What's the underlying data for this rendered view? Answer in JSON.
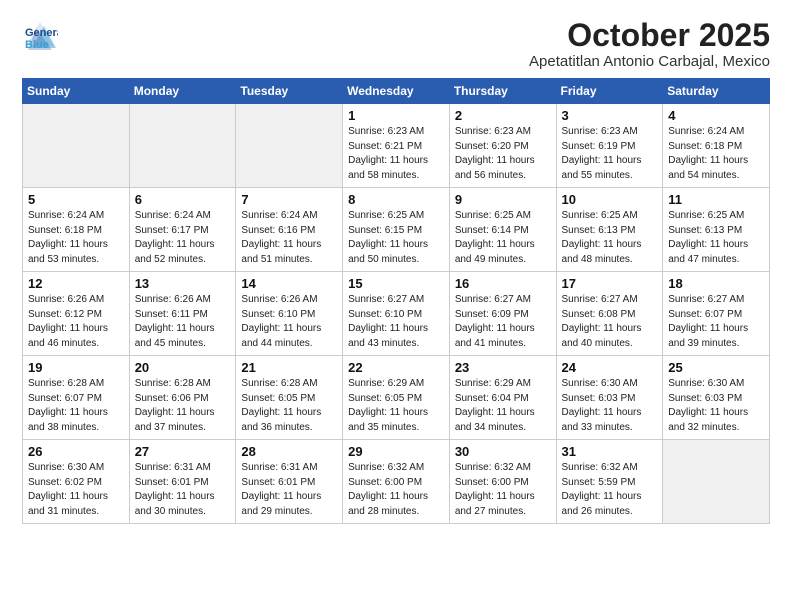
{
  "header": {
    "logo_general": "General",
    "logo_blue": "Blue",
    "month_title": "October 2025",
    "location": "Apetatitlan Antonio Carbajal, Mexico"
  },
  "weekdays": [
    "Sunday",
    "Monday",
    "Tuesday",
    "Wednesday",
    "Thursday",
    "Friday",
    "Saturday"
  ],
  "weeks": [
    [
      {
        "day": "",
        "info": ""
      },
      {
        "day": "",
        "info": ""
      },
      {
        "day": "",
        "info": ""
      },
      {
        "day": "1",
        "info": "Sunrise: 6:23 AM\nSunset: 6:21 PM\nDaylight: 11 hours\nand 58 minutes."
      },
      {
        "day": "2",
        "info": "Sunrise: 6:23 AM\nSunset: 6:20 PM\nDaylight: 11 hours\nand 56 minutes."
      },
      {
        "day": "3",
        "info": "Sunrise: 6:23 AM\nSunset: 6:19 PM\nDaylight: 11 hours\nand 55 minutes."
      },
      {
        "day": "4",
        "info": "Sunrise: 6:24 AM\nSunset: 6:18 PM\nDaylight: 11 hours\nand 54 minutes."
      }
    ],
    [
      {
        "day": "5",
        "info": "Sunrise: 6:24 AM\nSunset: 6:18 PM\nDaylight: 11 hours\nand 53 minutes."
      },
      {
        "day": "6",
        "info": "Sunrise: 6:24 AM\nSunset: 6:17 PM\nDaylight: 11 hours\nand 52 minutes."
      },
      {
        "day": "7",
        "info": "Sunrise: 6:24 AM\nSunset: 6:16 PM\nDaylight: 11 hours\nand 51 minutes."
      },
      {
        "day": "8",
        "info": "Sunrise: 6:25 AM\nSunset: 6:15 PM\nDaylight: 11 hours\nand 50 minutes."
      },
      {
        "day": "9",
        "info": "Sunrise: 6:25 AM\nSunset: 6:14 PM\nDaylight: 11 hours\nand 49 minutes."
      },
      {
        "day": "10",
        "info": "Sunrise: 6:25 AM\nSunset: 6:13 PM\nDaylight: 11 hours\nand 48 minutes."
      },
      {
        "day": "11",
        "info": "Sunrise: 6:25 AM\nSunset: 6:13 PM\nDaylight: 11 hours\nand 47 minutes."
      }
    ],
    [
      {
        "day": "12",
        "info": "Sunrise: 6:26 AM\nSunset: 6:12 PM\nDaylight: 11 hours\nand 46 minutes."
      },
      {
        "day": "13",
        "info": "Sunrise: 6:26 AM\nSunset: 6:11 PM\nDaylight: 11 hours\nand 45 minutes."
      },
      {
        "day": "14",
        "info": "Sunrise: 6:26 AM\nSunset: 6:10 PM\nDaylight: 11 hours\nand 44 minutes."
      },
      {
        "day": "15",
        "info": "Sunrise: 6:27 AM\nSunset: 6:10 PM\nDaylight: 11 hours\nand 43 minutes."
      },
      {
        "day": "16",
        "info": "Sunrise: 6:27 AM\nSunset: 6:09 PM\nDaylight: 11 hours\nand 41 minutes."
      },
      {
        "day": "17",
        "info": "Sunrise: 6:27 AM\nSunset: 6:08 PM\nDaylight: 11 hours\nand 40 minutes."
      },
      {
        "day": "18",
        "info": "Sunrise: 6:27 AM\nSunset: 6:07 PM\nDaylight: 11 hours\nand 39 minutes."
      }
    ],
    [
      {
        "day": "19",
        "info": "Sunrise: 6:28 AM\nSunset: 6:07 PM\nDaylight: 11 hours\nand 38 minutes."
      },
      {
        "day": "20",
        "info": "Sunrise: 6:28 AM\nSunset: 6:06 PM\nDaylight: 11 hours\nand 37 minutes."
      },
      {
        "day": "21",
        "info": "Sunrise: 6:28 AM\nSunset: 6:05 PM\nDaylight: 11 hours\nand 36 minutes."
      },
      {
        "day": "22",
        "info": "Sunrise: 6:29 AM\nSunset: 6:05 PM\nDaylight: 11 hours\nand 35 minutes."
      },
      {
        "day": "23",
        "info": "Sunrise: 6:29 AM\nSunset: 6:04 PM\nDaylight: 11 hours\nand 34 minutes."
      },
      {
        "day": "24",
        "info": "Sunrise: 6:30 AM\nSunset: 6:03 PM\nDaylight: 11 hours\nand 33 minutes."
      },
      {
        "day": "25",
        "info": "Sunrise: 6:30 AM\nSunset: 6:03 PM\nDaylight: 11 hours\nand 32 minutes."
      }
    ],
    [
      {
        "day": "26",
        "info": "Sunrise: 6:30 AM\nSunset: 6:02 PM\nDaylight: 11 hours\nand 31 minutes."
      },
      {
        "day": "27",
        "info": "Sunrise: 6:31 AM\nSunset: 6:01 PM\nDaylight: 11 hours\nand 30 minutes."
      },
      {
        "day": "28",
        "info": "Sunrise: 6:31 AM\nSunset: 6:01 PM\nDaylight: 11 hours\nand 29 minutes."
      },
      {
        "day": "29",
        "info": "Sunrise: 6:32 AM\nSunset: 6:00 PM\nDaylight: 11 hours\nand 28 minutes."
      },
      {
        "day": "30",
        "info": "Sunrise: 6:32 AM\nSunset: 6:00 PM\nDaylight: 11 hours\nand 27 minutes."
      },
      {
        "day": "31",
        "info": "Sunrise: 6:32 AM\nSunset: 5:59 PM\nDaylight: 11 hours\nand 26 minutes."
      },
      {
        "day": "",
        "info": ""
      }
    ]
  ]
}
